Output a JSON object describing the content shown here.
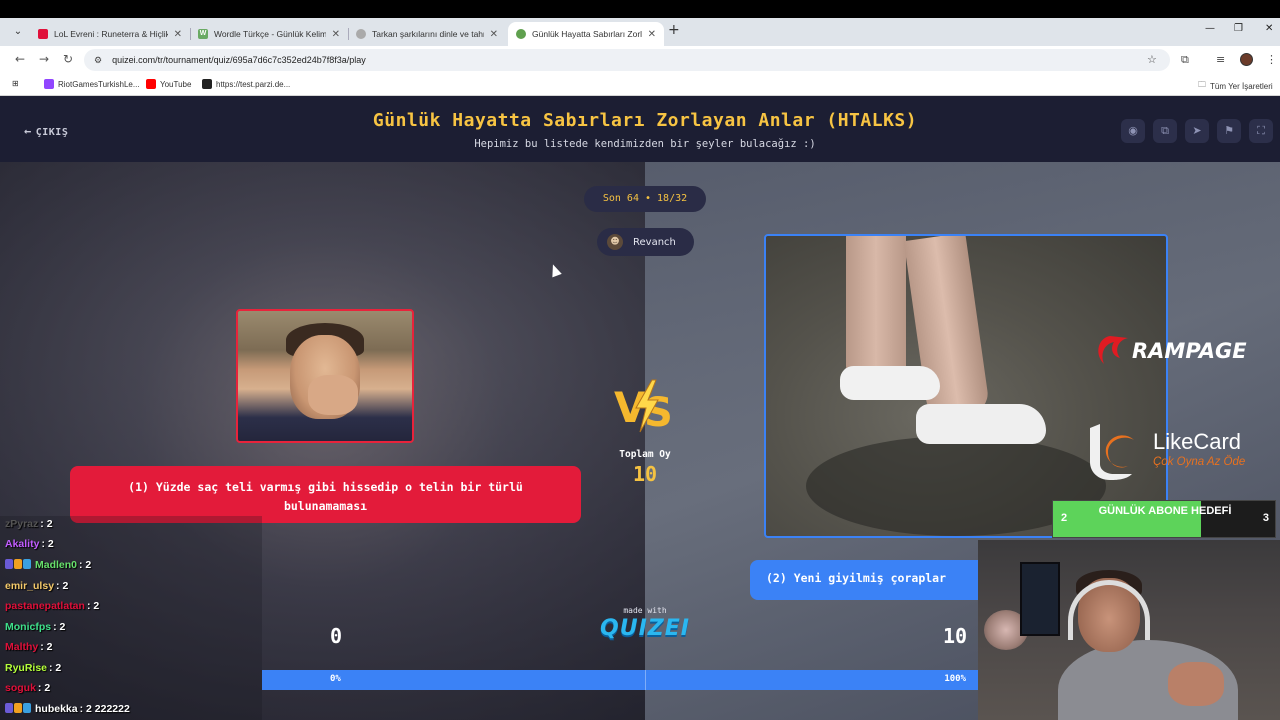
{
  "browser": {
    "tabs": [
      {
        "title": "LoL Evreni : Runeterra & Hiçlik",
        "favicon_color": "#e0103a"
      },
      {
        "title": "Wordle Türkçe - Günlük Kelime",
        "favicon_color": "#6aaa64",
        "favicon_text": "W"
      },
      {
        "title": "Tarkan şarkılarını dinle ve tahmi",
        "favicon_color": "#888888"
      },
      {
        "title": "Günlük Hayatta Sabırları Zorlay",
        "favicon_color": "#5fa04e",
        "active": true
      }
    ],
    "url": "quizei.com/tr/tournament/quiz/695a7d6c7c352ed24b7f8f3a/play",
    "bookmarks": [
      {
        "label": "RiotGamesTurkishLe...",
        "favicon_color": "#9146ff"
      },
      {
        "label": "YouTube",
        "favicon_color": "#ff0000"
      },
      {
        "label": "https://test.parzi.de...",
        "favicon_color": "#222222"
      }
    ],
    "all_bookmarks_label": "Tüm Yer İşaretleri"
  },
  "quiz": {
    "back_label": "ÇIKIŞ",
    "title": "Günlük Hayatta Sabırları Zorlayan Anlar (HTALKS)",
    "subtitle": "Hepimiz bu listede kendimizden bir şeyler bulacağız :)",
    "round": "Son 64 • 18/32",
    "revanch_label": "Revanch",
    "total_votes_label": "Toplam Oy",
    "total_votes": "10",
    "left": {
      "caption": "(1) Yüzde saç teli varmış gibi hissedip o telin bir türlü bulunamaması",
      "score": "0",
      "percent_label": "0%"
    },
    "right": {
      "caption": "(2) Yeni giyilmiş çoraplar",
      "score": "10",
      "percent_label": "100%"
    },
    "right_share": 1.0,
    "made_with": "made with",
    "brand": "QUIZEI",
    "colors": {
      "accent": "#f7c443",
      "left": "#e31b3a",
      "right": "#3b82f6",
      "header": "#1c1e33"
    }
  },
  "overlay": {
    "chat": [
      {
        "user": "zPyraz",
        "value": ": 2",
        "color": "#555555"
      },
      {
        "user": "Akality",
        "value": ": 2",
        "color": "#c15cff"
      },
      {
        "user": "Madlen0",
        "value": ": 2",
        "color": "#67e06b",
        "badges": true
      },
      {
        "user": "emir_ulsy",
        "value": ": 2",
        "color": "#f3c96a"
      },
      {
        "user": "pastanepatlatan",
        "value": ": 2",
        "color": "#e0103a"
      },
      {
        "user": "Monicfps",
        "value": ": 2",
        "color": "#3ee08a"
      },
      {
        "user": "Malthy",
        "value": ": 2",
        "color": "#e0103a"
      },
      {
        "user": "RyuRise",
        "value": ": 2",
        "color": "#b5ff3a"
      },
      {
        "user": "soguk",
        "value": ": 2",
        "color": "#e0103a"
      },
      {
        "user": "hubekka",
        "value": ": 2 222222",
        "color": "#ffffff",
        "badges": true
      }
    ],
    "sponsor1": "RAMPAGE",
    "sponsor2": "LikeCard",
    "sponsor2_tagline": "Çok Oyna  Az Öde",
    "goal": {
      "label": "GÜNLÜK ABONE HEDEFİ",
      "current": "2",
      "target": "3",
      "progress": 0.667
    }
  }
}
